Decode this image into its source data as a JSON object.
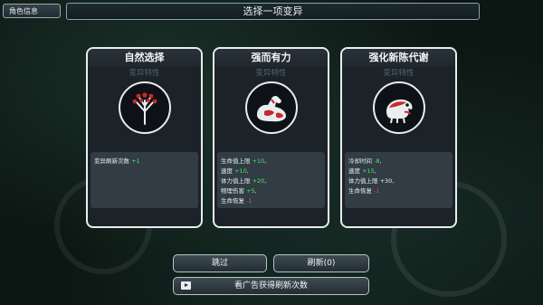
{
  "header": {
    "role_info_label": "角色信息",
    "title": "选择一项变异"
  },
  "cards": [
    {
      "title": "自然选择",
      "subtitle": "变异特性",
      "icon": "tree-icon",
      "stats": [
        {
          "label": "变异刷新次数 ",
          "value": "+1",
          "tone": "pos",
          "suffix": ""
        }
      ]
    },
    {
      "title": "强而有力",
      "subtitle": "变异特性",
      "icon": "flexed-arm-icon",
      "stats": [
        {
          "label": "生命值上限 ",
          "value": "+10",
          "tone": "pos",
          "suffix": ","
        },
        {
          "label": "速度 ",
          "value": "+10",
          "tone": "pos",
          "suffix": ","
        },
        {
          "label": "体力值上限 ",
          "value": "+20",
          "tone": "pos",
          "suffix": ","
        },
        {
          "label": "物理伤害 ",
          "value": "+5",
          "tone": "pos",
          "suffix": ","
        },
        {
          "label": "生命恢复 ",
          "value": "-1",
          "tone": "neg",
          "suffix": ""
        }
      ]
    },
    {
      "title": "强化新陈代谢",
      "subtitle": "变异特性",
      "icon": "creature-icon",
      "stats": [
        {
          "label": "冷却时间 ",
          "value": "-8",
          "tone": "pos",
          "suffix": ","
        },
        {
          "label": "速度 ",
          "value": "+15",
          "tone": "pos",
          "suffix": ","
        },
        {
          "label": "体力值上限 ",
          "value": "+30",
          "tone": "none",
          "suffix": ","
        },
        {
          "label": "生命恢复 ",
          "value": "-1",
          "tone": "neg",
          "suffix": ""
        }
      ]
    }
  ],
  "buttons": {
    "skip_label": "跳过",
    "refresh_label": "刷新(0)",
    "ad_label": "看广告获得刷新次数"
  },
  "colors": {
    "positive": "#4ce66a",
    "negative": "#e84a4a",
    "accent_red": "#c8292e"
  }
}
